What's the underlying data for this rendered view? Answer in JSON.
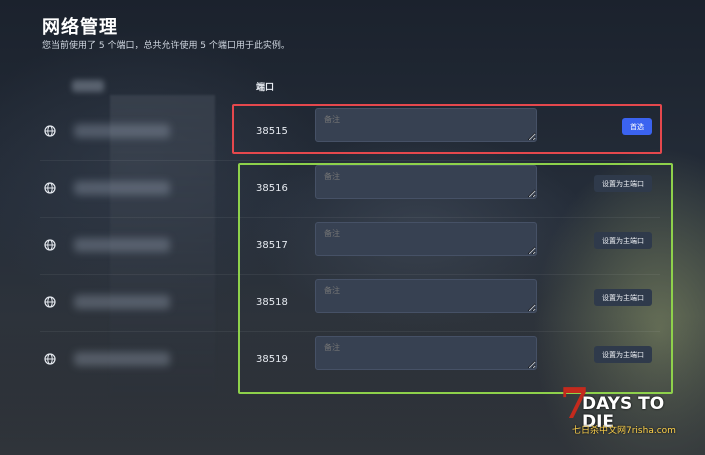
{
  "header": {
    "title": "网络管理",
    "subtitle": "您当前使用了 5 个端口，总共允许使用 5 个端口用于此实例。"
  },
  "table": {
    "port_header": "端口",
    "rows": [
      {
        "port": "38515",
        "note_placeholder": "备注",
        "action_label": "首选",
        "action_type": "primary",
        "icon": "globe-icon"
      },
      {
        "port": "38516",
        "note_placeholder": "备注",
        "action_label": "设置为主端口",
        "action_type": "set-primary",
        "icon": "globe-icon"
      },
      {
        "port": "38517",
        "note_placeholder": "备注",
        "action_label": "设置为主端口",
        "action_type": "set-primary",
        "icon": "globe-icon"
      },
      {
        "port": "38518",
        "note_placeholder": "备注",
        "action_label": "设置为主端口",
        "action_type": "set-primary",
        "icon": "globe-icon"
      },
      {
        "port": "38519",
        "note_placeholder": "备注",
        "action_label": "设置为主端口",
        "action_type": "set-primary",
        "icon": "globe-icon"
      }
    ]
  },
  "annotations": {
    "red_box_color": "#e5484d",
    "green_box_color": "#8ed14b"
  },
  "watermark": {
    "seven": "7",
    "main": "DAYS TO DIE",
    "sub": "七日杀中文网7risha.com"
  },
  "colors": {
    "primary_button": "#3b63f0",
    "secondary_button": "#2f3a4b",
    "input_bg": "#374152"
  }
}
